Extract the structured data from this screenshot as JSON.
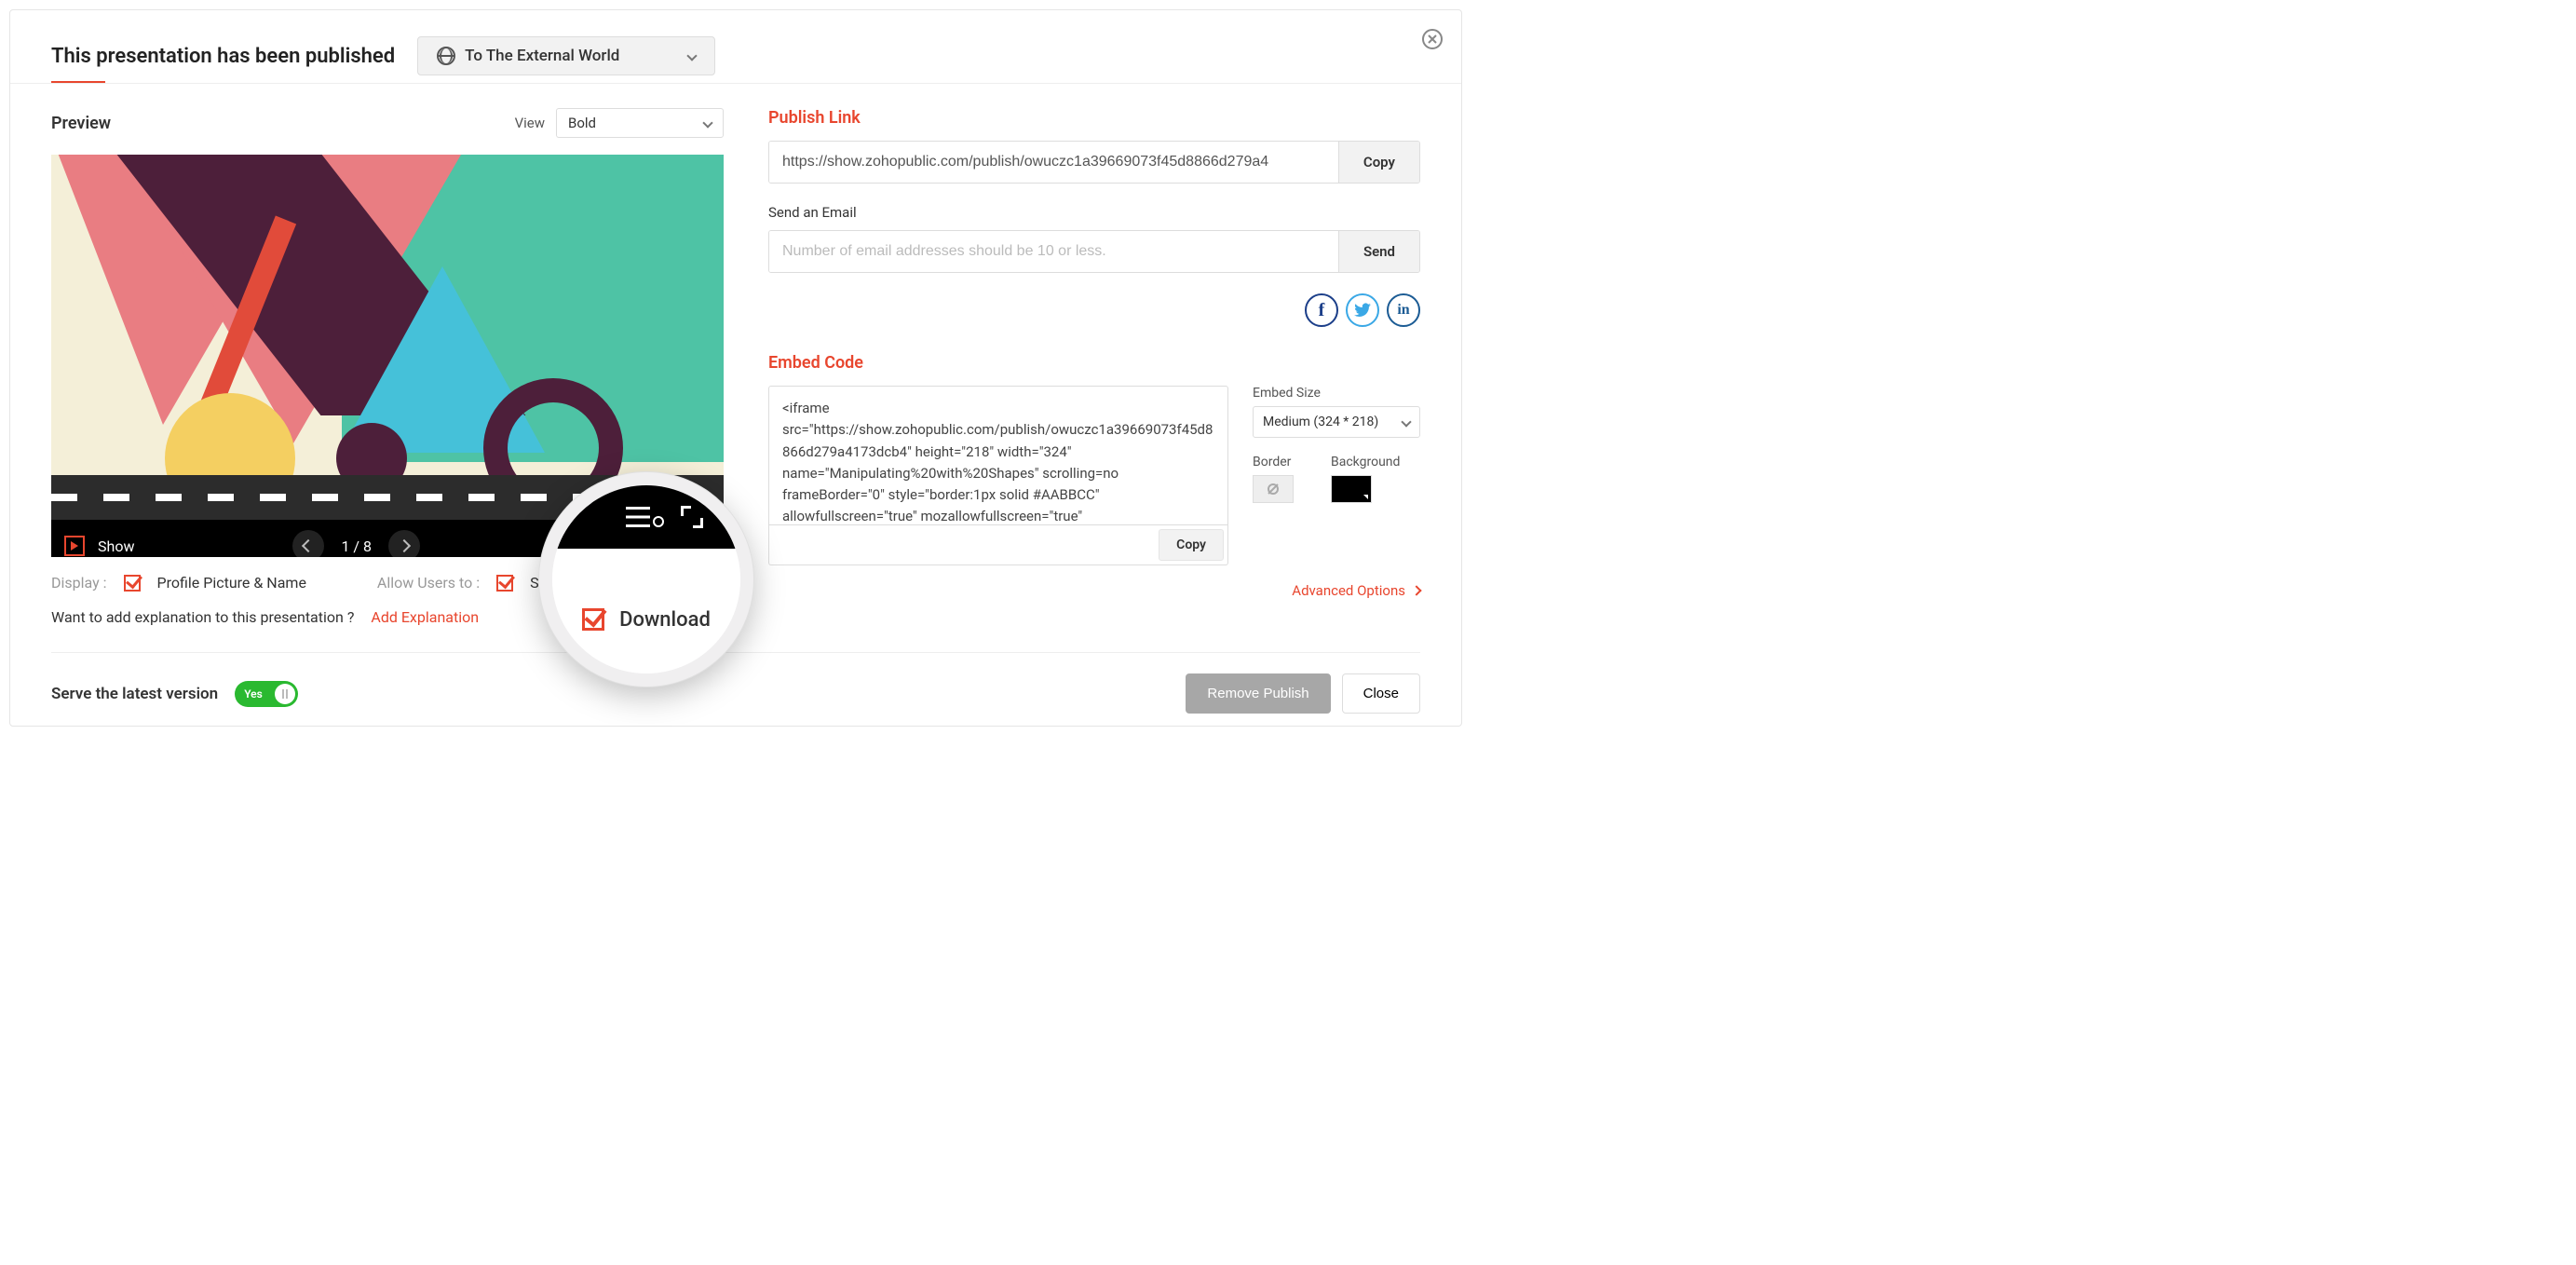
{
  "header": {
    "title": "This presentation has been published",
    "visibility": "To The External World"
  },
  "preview": {
    "label": "Preview",
    "view_label": "View",
    "view_value": "Bold",
    "show_label": "Show",
    "page_indicator": "1 / 8"
  },
  "options": {
    "display_label": "Display :",
    "display_item": "Profile Picture & Name",
    "allow_label": "Allow Users to :",
    "allow_share": "Share",
    "magnified_action": "Download",
    "explain_prompt": "Want to add explanation to this presentation ?",
    "explain_action": "Add Explanation"
  },
  "publish": {
    "link_heading": "Publish Link",
    "link_value": "https://show.zohopublic.com/publish/owuczc1a39669073f45d8866d279a4",
    "copy": "Copy",
    "send_email_label": "Send an Email",
    "email_placeholder": "Number of email addresses should be 10 or less.",
    "send": "Send"
  },
  "embed": {
    "heading": "Embed Code",
    "code": "<iframe src=\"https://show.zohopublic.com/publish/owuczc1a39669073f45d8866d279a4173dcb4\" height=\"218\" width=\"324\" name=\"Manipulating%20with%20Shapes\" scrolling=no frameBorder=\"0\" style=\"border:1px solid #AABBCC\" allowfullscreen=\"true\" mozallowfullscreen=\"true\" webkitallowfullscreen=\"true\"></iframe>",
    "copy": "Copy",
    "size_label": "Embed Size",
    "size_value": "Medium (324 * 218)",
    "border_label": "Border",
    "background_label": "Background",
    "advanced": "Advanced Options"
  },
  "footer": {
    "serve_latest": "Serve the latest version",
    "toggle_text": "Yes",
    "remove_publish": "Remove Publish",
    "close": "Close"
  }
}
